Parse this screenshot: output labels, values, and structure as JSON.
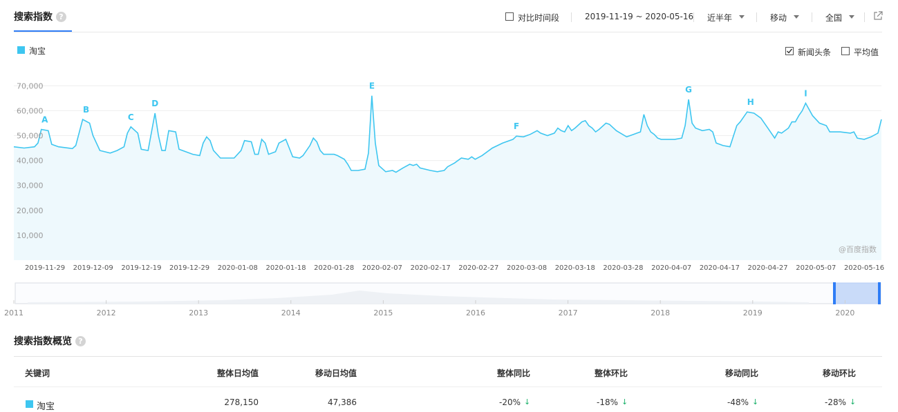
{
  "header": {
    "title": "搜索指数",
    "help": "?",
    "compare_label": "对比时间段",
    "date_range": "2019-11-19 ~ 2020-05-16",
    "period": "近半年",
    "device": "移动",
    "region": "全国"
  },
  "legend": {
    "series_name": "淘宝",
    "series_color": "#3ec6f0",
    "news_label": "新闻头条",
    "news_checked": true,
    "avg_label": "平均值",
    "avg_checked": false
  },
  "watermark": "@百度指数",
  "chart_data": {
    "type": "area",
    "series": [
      {
        "name": "淘宝",
        "color": "#3ec6f0"
      }
    ],
    "ylim": [
      0,
      77000
    ],
    "yticks": [
      "70,000",
      "60,000",
      "50,000",
      "40,000",
      "30,000",
      "20,000",
      "10,000"
    ],
    "ytick_values": [
      70000,
      60000,
      50000,
      40000,
      30000,
      20000,
      10000
    ],
    "xticks": [
      "2019-11-29",
      "2019-12-09",
      "2019-12-19",
      "2019-12-29",
      "2020-01-08",
      "2020-01-18",
      "2020-01-28",
      "2020-02-07",
      "2020-02-17",
      "2020-02-27",
      "2020-03-08",
      "2020-03-18",
      "2020-03-28",
      "2020-04-07",
      "2020-04-17",
      "2020-04-27",
      "2020-05-07",
      "2020-05-16"
    ],
    "points": [
      [
        0,
        45500
      ],
      [
        3,
        45000
      ],
      [
        6,
        45500
      ],
      [
        7,
        47000
      ],
      [
        8,
        52500
      ],
      [
        10,
        52000
      ],
      [
        11,
        46500
      ],
      [
        13,
        45500
      ],
      [
        17,
        44800
      ],
      [
        18,
        46000
      ],
      [
        20,
        56500
      ],
      [
        22,
        55000
      ],
      [
        23,
        50000
      ],
      [
        25,
        44000
      ],
      [
        28,
        43000
      ],
      [
        30,
        44000
      ],
      [
        32,
        45500
      ],
      [
        33,
        51000
      ],
      [
        34,
        53500
      ],
      [
        36,
        51000
      ],
      [
        37,
        44500
      ],
      [
        39,
        44000
      ],
      [
        40,
        51500
      ],
      [
        41,
        59000
      ],
      [
        42,
        50000
      ],
      [
        43,
        44000
      ],
      [
        44,
        44000
      ],
      [
        45,
        52000
      ],
      [
        47,
        51500
      ],
      [
        48,
        44500
      ],
      [
        52,
        42500
      ],
      [
        54,
        42000
      ],
      [
        55,
        47000
      ],
      [
        56,
        49500
      ],
      [
        57,
        48000
      ],
      [
        58,
        44000
      ],
      [
        60,
        41000
      ],
      [
        64,
        41000
      ],
      [
        66,
        44000
      ],
      [
        67,
        48000
      ],
      [
        69,
        47500
      ],
      [
        70,
        42500
      ],
      [
        71,
        42500
      ],
      [
        72,
        48500
      ],
      [
        73,
        47000
      ],
      [
        74,
        42500
      ],
      [
        76,
        43500
      ],
      [
        77,
        47000
      ],
      [
        79,
        48500
      ],
      [
        80,
        45000
      ],
      [
        81,
        41500
      ],
      [
        83,
        41000
      ],
      [
        84,
        42000
      ],
      [
        86,
        46000
      ],
      [
        87,
        49000
      ],
      [
        88,
        47500
      ],
      [
        89,
        44000
      ],
      [
        90,
        42500
      ],
      [
        93,
        42500
      ],
      [
        94,
        42000
      ],
      [
        96,
        40500
      ],
      [
        97,
        38500
      ],
      [
        98,
        36000
      ],
      [
        100,
        36000
      ],
      [
        102,
        36500
      ],
      [
        103,
        43000
      ],
      [
        104,
        66000
      ],
      [
        105,
        47000
      ],
      [
        106,
        38000
      ],
      [
        108,
        35500
      ],
      [
        110,
        36000
      ],
      [
        111,
        35300
      ],
      [
        113,
        37000
      ],
      [
        115,
        38500
      ],
      [
        116,
        38000
      ],
      [
        117,
        38500
      ],
      [
        118,
        37000
      ],
      [
        121,
        36000
      ],
      [
        123,
        35500
      ],
      [
        125,
        36000
      ],
      [
        126,
        37500
      ],
      [
        128,
        39000
      ],
      [
        130,
        41000
      ],
      [
        132,
        40500
      ],
      [
        133,
        41500
      ],
      [
        134,
        40500
      ],
      [
        136,
        42000
      ],
      [
        139,
        45000
      ],
      [
        142,
        47000
      ],
      [
        145,
        48500
      ],
      [
        146,
        49800
      ],
      [
        148,
        49500
      ],
      [
        150,
        50500
      ],
      [
        152,
        52000
      ],
      [
        153,
        51000
      ],
      [
        155,
        50000
      ],
      [
        157,
        51000
      ],
      [
        158,
        53000
      ],
      [
        159,
        52000
      ],
      [
        160,
        51500
      ],
      [
        161,
        54000
      ],
      [
        162,
        52000
      ],
      [
        163,
        53000
      ],
      [
        165,
        55500
      ],
      [
        166,
        56000
      ],
      [
        167,
        54000
      ],
      [
        168,
        53000
      ],
      [
        169,
        51500
      ],
      [
        170,
        52500
      ],
      [
        172,
        55000
      ],
      [
        173,
        54500
      ],
      [
        175,
        52000
      ],
      [
        178,
        49500
      ],
      [
        180,
        50500
      ],
      [
        181,
        51000
      ],
      [
        182,
        51500
      ],
      [
        183,
        58500
      ],
      [
        184,
        54000
      ],
      [
        185,
        51500
      ],
      [
        186,
        50500
      ],
      [
        187,
        49000
      ],
      [
        188,
        48500
      ],
      [
        192,
        48500
      ],
      [
        194,
        49000
      ],
      [
        195,
        54000
      ],
      [
        196,
        64500
      ],
      [
        197,
        55000
      ],
      [
        198,
        53000
      ],
      [
        200,
        52000
      ],
      [
        202,
        52500
      ],
      [
        203,
        51500
      ],
      [
        204,
        47000
      ],
      [
        206,
        46000
      ],
      [
        208,
        45500
      ],
      [
        210,
        54000
      ],
      [
        211,
        55500
      ],
      [
        213,
        59500
      ],
      [
        215,
        59000
      ],
      [
        217,
        57000
      ],
      [
        219,
        53000
      ],
      [
        221,
        49000
      ],
      [
        222,
        51500
      ],
      [
        223,
        51000
      ],
      [
        225,
        53000
      ],
      [
        226,
        55500
      ],
      [
        227,
        55500
      ],
      [
        228,
        58000
      ],
      [
        229,
        60000
      ],
      [
        230,
        63000
      ],
      [
        232,
        58000
      ],
      [
        234,
        55000
      ],
      [
        236,
        54000
      ],
      [
        237,
        51500
      ],
      [
        240,
        51500
      ],
      [
        243,
        51000
      ],
      [
        244,
        51500
      ],
      [
        245,
        49000
      ],
      [
        247,
        48500
      ],
      [
        249,
        49500
      ],
      [
        251,
        51000
      ],
      [
        252,
        56500
      ]
    ],
    "annotations": [
      {
        "label": "A",
        "x": 9,
        "y": 52500
      },
      {
        "label": "B",
        "x": 21,
        "y": 56500
      },
      {
        "label": "C",
        "x": 34,
        "y": 53500
      },
      {
        "label": "D",
        "x": 41,
        "y": 59000
      },
      {
        "label": "E",
        "x": 104,
        "y": 66000
      },
      {
        "label": "F",
        "x": 146,
        "y": 49800
      },
      {
        "label": "G",
        "x": 196,
        "y": 64500
      },
      {
        "label": "H",
        "x": 214,
        "y": 59500
      },
      {
        "label": "I",
        "x": 230,
        "y": 63000
      }
    ],
    "grid": true,
    "legend_position": "top-left"
  },
  "range_slider": {
    "years": [
      "2011",
      "2012",
      "2013",
      "2014",
      "2015",
      "2016",
      "2017",
      "2018",
      "2019",
      "2020"
    ]
  },
  "overview": {
    "title": "搜索指数概览",
    "help": "?",
    "headers": [
      "关键词",
      "整体日均值",
      "移动日均值",
      "整体同比",
      "整体环比",
      "移动同比",
      "移动环比"
    ],
    "row": {
      "keyword": "淘宝",
      "overall_avg": "278,150",
      "mobile_avg": "47,386",
      "overall_yoy": "-20%",
      "overall_mom": "-18%",
      "mobile_yoy": "-48%",
      "mobile_mom": "-28%",
      "arrow": "↓"
    }
  }
}
